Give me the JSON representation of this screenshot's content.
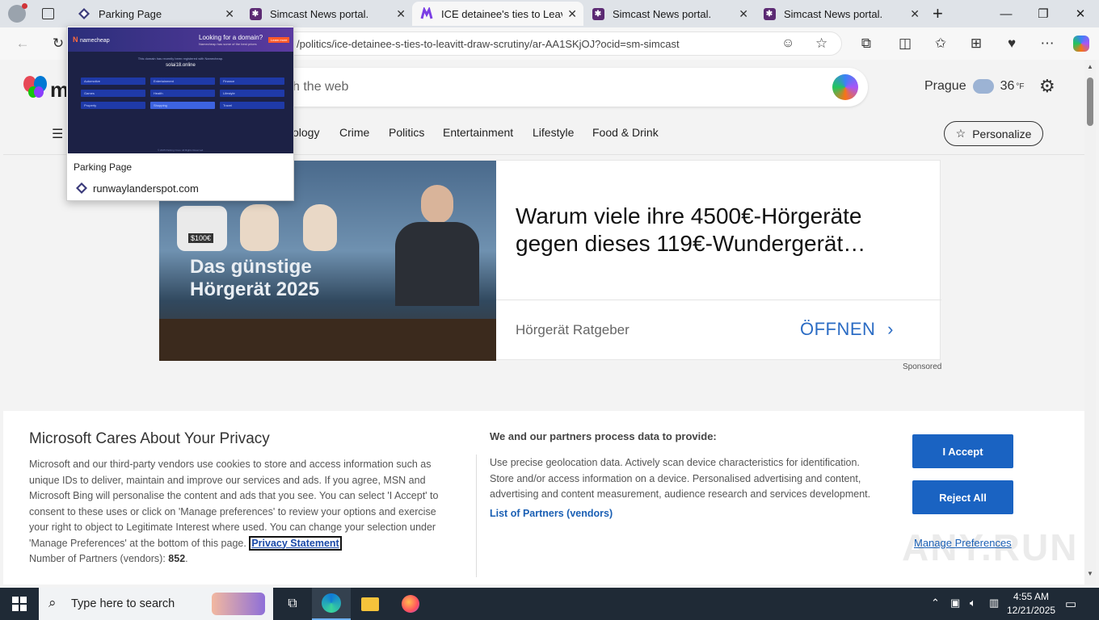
{
  "tabs": [
    {
      "label": "Parking Page",
      "active": false
    },
    {
      "label": "Simcast News portal.",
      "active": false
    },
    {
      "label": "ICE detainee's ties to Leavitt",
      "active": true
    },
    {
      "label": "Simcast News portal.",
      "active": false
    },
    {
      "label": "Simcast News portal.",
      "active": false
    }
  ],
  "address": {
    "url": "/politics/ice-detainee-s-ties-to-leavitt-draw-scrutiny/ar-AA1SKjOJ?ocid=sm-simcast"
  },
  "preview": {
    "title": "Parking Page",
    "url": "runwaylanderspot.com",
    "thumb_brand": "namecheap",
    "thumb_headline": "Looking for a domain?",
    "thumb_sub": "Namecheap has some of the best prices",
    "thumb_cta": "Learn more",
    "thumb_note": "This domain has recently been registered with Namecheap.",
    "thumb_domain": "solai18.online",
    "thumb_cells": [
      "Automotive",
      "Entertainment",
      "Finance",
      "Games",
      "Health",
      "Lifestyle",
      "Property",
      "Shopping",
      "Travel"
    ],
    "thumb_footer": "© 2025 Parking Crew. All Rights Reserved."
  },
  "header": {
    "logo_letter": "m",
    "search_placeholder": "ch the web",
    "weather_city": "Prague",
    "weather_temp": "36",
    "weather_unit": "°F"
  },
  "nav": {
    "items": [
      "ology",
      "Crime",
      "Politics",
      "Entertainment",
      "Lifestyle",
      "Food & Drink"
    ],
    "personalize": "Personalize"
  },
  "ad": {
    "image_text": "Das günstige Hörgerät 2025",
    "box_label": "$100€",
    "headline": "Warum viele ihre 4500€-Hörgeräte gegen dieses 119€-Wundergerät…",
    "source": "Hörgerät Ratgeber",
    "cta": "ÖFFNEN",
    "sponsored": "Sponsored"
  },
  "consent": {
    "title": "Microsoft Cares About Your Privacy",
    "body": "Microsoft and our third-party vendors use cookies to store and access information such as unique IDs to deliver, maintain and improve our services and ads. If you agree, MSN and Microsoft Bing will personalise the content and ads that you see. You can select 'I Accept' to consent to these uses or click on 'Manage preferences' to review your options and exercise your right to object to Legitimate Interest where used.  You can change your selection under 'Manage Preferences' at the bottom of this page.",
    "privacy_link": "Privacy Statement",
    "partners_label": "Number of Partners (vendors):",
    "partners_count": "852",
    "process_title": "We and our partners process data to provide:",
    "process_body": "Use precise geolocation data. Actively scan device characteristics for identification. Store and/or access information on a device. Personalised advertising and content, advertising and content measurement, audience research and services development.",
    "partners_link": "List of Partners (vendors)",
    "accept": "I Accept",
    "reject": "Reject All",
    "manage": "Manage Preferences",
    "watermark": "ANY.RUN"
  },
  "taskbar": {
    "search_placeholder": "Type here to search",
    "time": "4:55 AM",
    "date": "12/21/2025"
  },
  "colors": {
    "accent": "#1a63c2",
    "taskbar": "#1f2a36",
    "tabstrip": "#dfe3e8"
  }
}
